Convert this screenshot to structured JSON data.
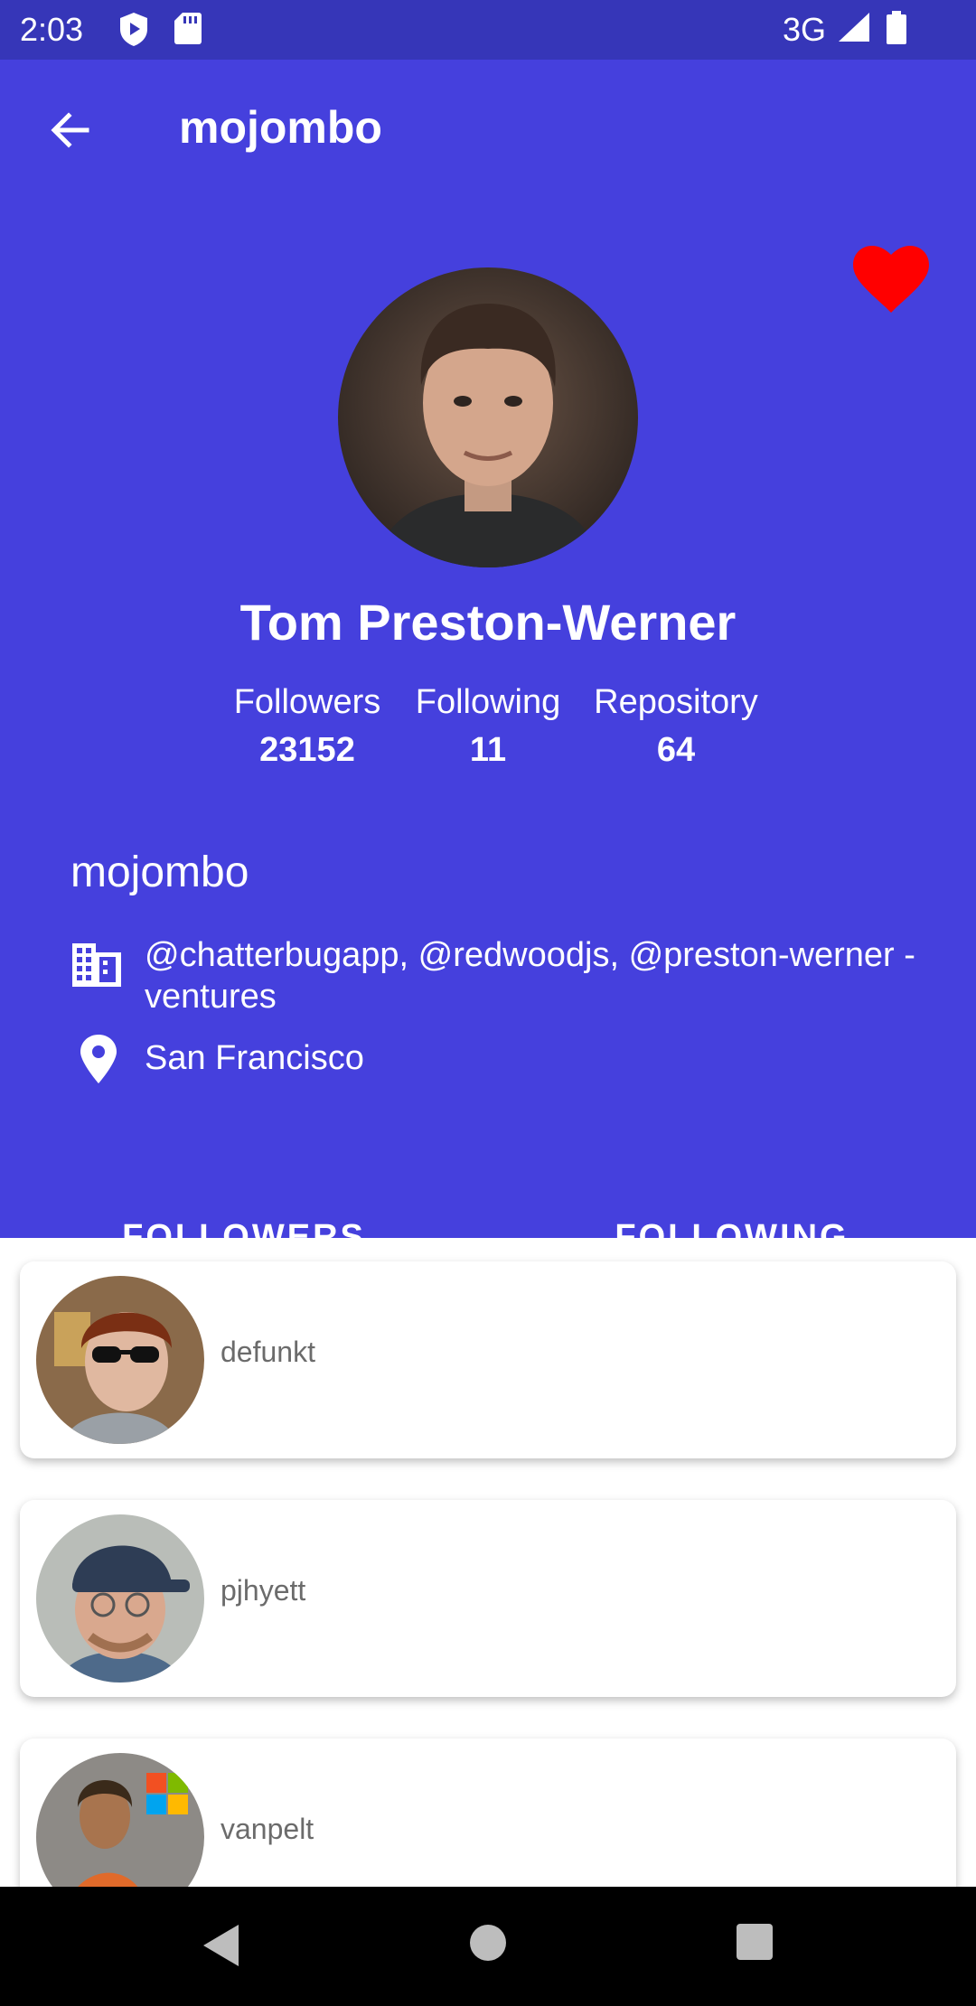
{
  "status": {
    "time": "2:03",
    "network": "3G"
  },
  "appbar": {
    "title": "mojombo"
  },
  "profile": {
    "name": "Tom Preston-Werner",
    "login": "mojombo",
    "company": "@chatterbugapp, @redwoodjs, @preston-werner -ventures",
    "location": "San Francisco",
    "favorited": true,
    "stats": [
      {
        "label": "Followers",
        "value": "23152"
      },
      {
        "label": "Following",
        "value": "11"
      },
      {
        "label": "Repository",
        "value": "64"
      }
    ]
  },
  "tabs": [
    {
      "label": "FOLLOWERS",
      "selected": true
    },
    {
      "label": "FOLLOWING",
      "selected": false
    }
  ],
  "followers": [
    {
      "login": "defunkt"
    },
    {
      "login": "pjhyett"
    },
    {
      "login": "vanpelt"
    }
  ],
  "colors": {
    "primary": "#4540dd",
    "status_bar": "#3636b8",
    "heart": "#ff0000"
  }
}
